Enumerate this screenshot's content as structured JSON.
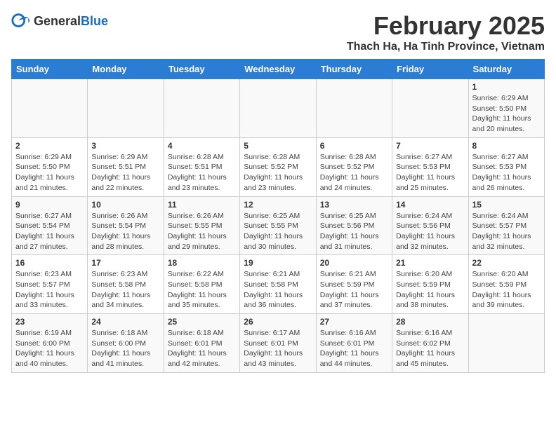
{
  "header": {
    "logo_general": "General",
    "logo_blue": "Blue",
    "title": "February 2025",
    "subtitle": "Thach Ha, Ha Tinh Province, Vietnam"
  },
  "calendar": {
    "days_of_week": [
      "Sunday",
      "Monday",
      "Tuesday",
      "Wednesday",
      "Thursday",
      "Friday",
      "Saturday"
    ],
    "weeks": [
      [
        {
          "day": "",
          "info": ""
        },
        {
          "day": "",
          "info": ""
        },
        {
          "day": "",
          "info": ""
        },
        {
          "day": "",
          "info": ""
        },
        {
          "day": "",
          "info": ""
        },
        {
          "day": "",
          "info": ""
        },
        {
          "day": "1",
          "info": "Sunrise: 6:29 AM\nSunset: 5:50 PM\nDaylight: 11 hours and 20 minutes."
        }
      ],
      [
        {
          "day": "2",
          "info": "Sunrise: 6:29 AM\nSunset: 5:50 PM\nDaylight: 11 hours and 21 minutes."
        },
        {
          "day": "3",
          "info": "Sunrise: 6:29 AM\nSunset: 5:51 PM\nDaylight: 11 hours and 22 minutes."
        },
        {
          "day": "4",
          "info": "Sunrise: 6:28 AM\nSunset: 5:51 PM\nDaylight: 11 hours and 23 minutes."
        },
        {
          "day": "5",
          "info": "Sunrise: 6:28 AM\nSunset: 5:52 PM\nDaylight: 11 hours and 23 minutes."
        },
        {
          "day": "6",
          "info": "Sunrise: 6:28 AM\nSunset: 5:52 PM\nDaylight: 11 hours and 24 minutes."
        },
        {
          "day": "7",
          "info": "Sunrise: 6:27 AM\nSunset: 5:53 PM\nDaylight: 11 hours and 25 minutes."
        },
        {
          "day": "8",
          "info": "Sunrise: 6:27 AM\nSunset: 5:53 PM\nDaylight: 11 hours and 26 minutes."
        }
      ],
      [
        {
          "day": "9",
          "info": "Sunrise: 6:27 AM\nSunset: 5:54 PM\nDaylight: 11 hours and 27 minutes."
        },
        {
          "day": "10",
          "info": "Sunrise: 6:26 AM\nSunset: 5:54 PM\nDaylight: 11 hours and 28 minutes."
        },
        {
          "day": "11",
          "info": "Sunrise: 6:26 AM\nSunset: 5:55 PM\nDaylight: 11 hours and 29 minutes."
        },
        {
          "day": "12",
          "info": "Sunrise: 6:25 AM\nSunset: 5:55 PM\nDaylight: 11 hours and 30 minutes."
        },
        {
          "day": "13",
          "info": "Sunrise: 6:25 AM\nSunset: 5:56 PM\nDaylight: 11 hours and 31 minutes."
        },
        {
          "day": "14",
          "info": "Sunrise: 6:24 AM\nSunset: 5:56 PM\nDaylight: 11 hours and 32 minutes."
        },
        {
          "day": "15",
          "info": "Sunrise: 6:24 AM\nSunset: 5:57 PM\nDaylight: 11 hours and 32 minutes."
        }
      ],
      [
        {
          "day": "16",
          "info": "Sunrise: 6:23 AM\nSunset: 5:57 PM\nDaylight: 11 hours and 33 minutes."
        },
        {
          "day": "17",
          "info": "Sunrise: 6:23 AM\nSunset: 5:58 PM\nDaylight: 11 hours and 34 minutes."
        },
        {
          "day": "18",
          "info": "Sunrise: 6:22 AM\nSunset: 5:58 PM\nDaylight: 11 hours and 35 minutes."
        },
        {
          "day": "19",
          "info": "Sunrise: 6:21 AM\nSunset: 5:58 PM\nDaylight: 11 hours and 36 minutes."
        },
        {
          "day": "20",
          "info": "Sunrise: 6:21 AM\nSunset: 5:59 PM\nDaylight: 11 hours and 37 minutes."
        },
        {
          "day": "21",
          "info": "Sunrise: 6:20 AM\nSunset: 5:59 PM\nDaylight: 11 hours and 38 minutes."
        },
        {
          "day": "22",
          "info": "Sunrise: 6:20 AM\nSunset: 5:59 PM\nDaylight: 11 hours and 39 minutes."
        }
      ],
      [
        {
          "day": "23",
          "info": "Sunrise: 6:19 AM\nSunset: 6:00 PM\nDaylight: 11 hours and 40 minutes."
        },
        {
          "day": "24",
          "info": "Sunrise: 6:18 AM\nSunset: 6:00 PM\nDaylight: 11 hours and 41 minutes."
        },
        {
          "day": "25",
          "info": "Sunrise: 6:18 AM\nSunset: 6:01 PM\nDaylight: 11 hours and 42 minutes."
        },
        {
          "day": "26",
          "info": "Sunrise: 6:17 AM\nSunset: 6:01 PM\nDaylight: 11 hours and 43 minutes."
        },
        {
          "day": "27",
          "info": "Sunrise: 6:16 AM\nSunset: 6:01 PM\nDaylight: 11 hours and 44 minutes."
        },
        {
          "day": "28",
          "info": "Sunrise: 6:16 AM\nSunset: 6:02 PM\nDaylight: 11 hours and 45 minutes."
        },
        {
          "day": "",
          "info": ""
        }
      ]
    ]
  }
}
